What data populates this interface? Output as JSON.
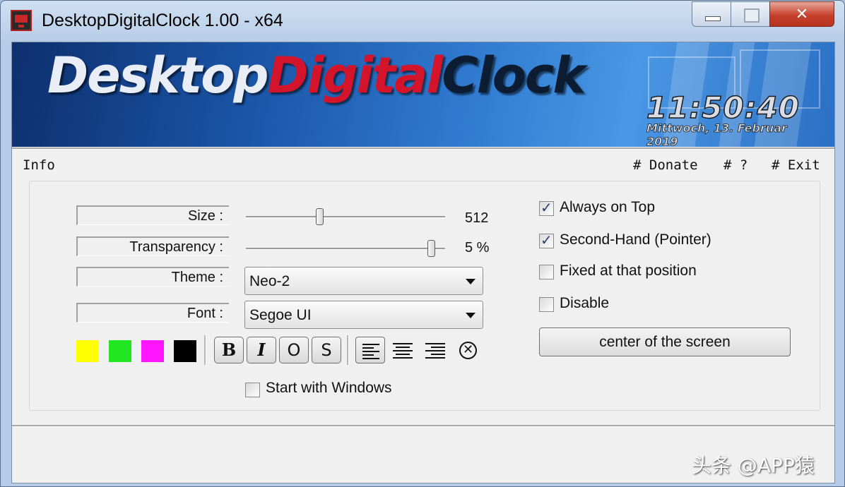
{
  "window": {
    "title": "DesktopDigitalClock 1.00 - x64",
    "controls": {
      "minimize": "minimize",
      "maximize": "maximize",
      "close": "✕"
    }
  },
  "banner": {
    "logo_part1": "Desktop",
    "logo_part2": "Digital",
    "logo_part3": "Clock",
    "time": "11:50:40",
    "date": "Mittwoch, 13. Februar 2019"
  },
  "menu": {
    "info": "Info",
    "donate": "# Donate",
    "help": "# ?",
    "exit": "# Exit"
  },
  "settings": {
    "size_label": "Size :",
    "size_value": "512",
    "size_level": 0.37,
    "transparency_label": "Transparency :",
    "transparency_value": "5 %",
    "transparency_level": 0.93,
    "theme_label": "Theme :",
    "theme_selected": "Neo-2",
    "font_label": "Font :",
    "font_selected": "Segoe UI"
  },
  "colors": [
    "#ffff00",
    "#22e622",
    "#ff14ff",
    "#000000"
  ],
  "format_buttons": {
    "bold": "B",
    "italic": "I",
    "outline": "O",
    "strike": "S"
  },
  "align_icons": [
    "align-left-icon",
    "align-center-icon",
    "align-right-icon",
    "clear-icon"
  ],
  "options": {
    "always_on_top": "Always on Top",
    "always_on_top_checked": true,
    "second_hand": "Second-Hand (Pointer)",
    "second_hand_checked": true,
    "fixed_position": "Fixed at that position",
    "fixed_position_checked": false,
    "disable": "Disable",
    "disable_checked": false,
    "start_with_windows": "Start with Windows",
    "start_with_windows_checked": false,
    "center_button": "center of the screen"
  },
  "watermark": "头条 @APP猿"
}
